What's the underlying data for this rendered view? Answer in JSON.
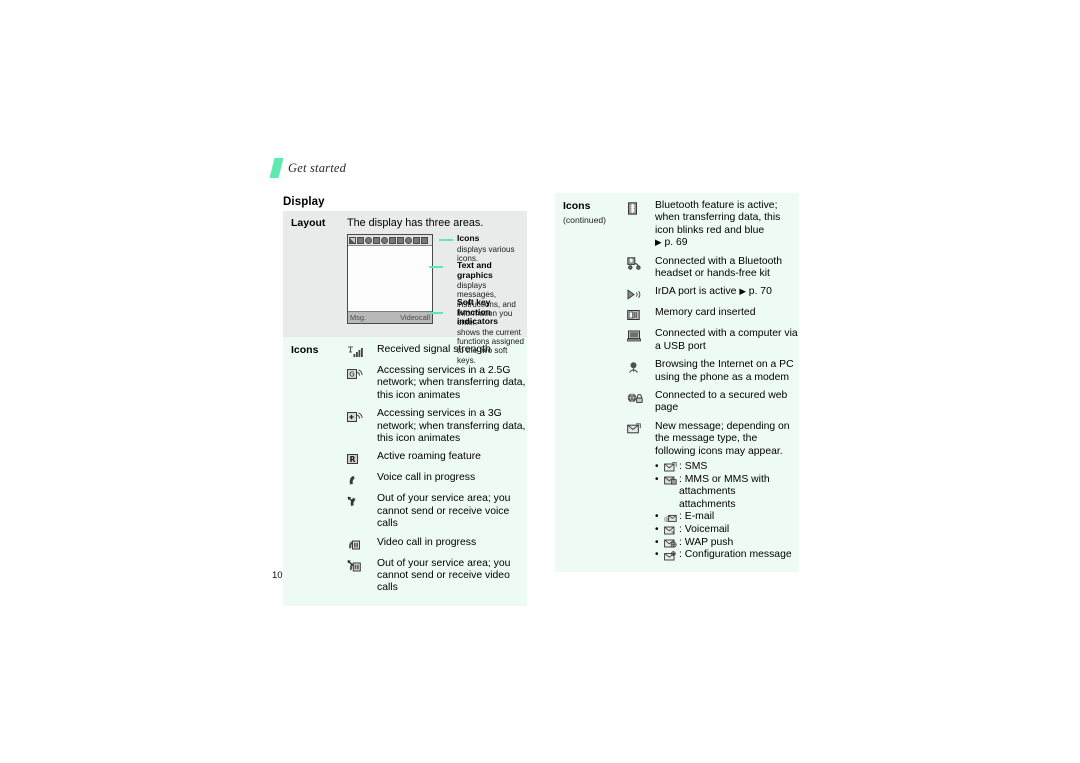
{
  "page": {
    "running_header": "Get started",
    "folio": "10",
    "section_heading": "Display",
    "accent_color": "#5ee9ae",
    "panel_gray": "#e9eaea",
    "panel_mint": "#eefaf4"
  },
  "layout_row": {
    "label": "Layout",
    "intro": "The display has three areas.",
    "softkeys": {
      "left": "Msg.",
      "right": "Videocall"
    },
    "callouts": [
      {
        "icon": "icons-callout-icon",
        "title": "Icons",
        "desc": "displays various icons."
      },
      {
        "icon": "text-graphics-callout-icon",
        "title": "Text and graphics",
        "desc": "displays messages, instructions, and information you enter."
      },
      {
        "icon": "softkey-callout-icon",
        "title": "Soft key function indicators",
        "desc": "shows the current functions assigned to the two soft keys."
      }
    ]
  },
  "icons_row_left": {
    "label": "Icons",
    "items": [
      {
        "icon": "signal-strength-icon",
        "text": "Received signal strength"
      },
      {
        "icon": "network-2-5g-icon",
        "text": "Accessing services in a 2.5G network; when transferring data, this icon animates"
      },
      {
        "icon": "network-3g-icon",
        "text": "Accessing services in a 3G network; when transferring data, this icon animates"
      },
      {
        "icon": "roaming-icon",
        "text": "Active roaming feature"
      },
      {
        "icon": "voice-call-icon",
        "text": "Voice call in progress"
      },
      {
        "icon": "voice-call-no-service-icon",
        "text": "Out of your service area; you cannot send or receive voice calls"
      },
      {
        "icon": "video-call-icon",
        "text": "Video call in progress"
      },
      {
        "icon": "video-call-no-service-icon",
        "text": "Out of your service area; you cannot send or receive video calls"
      }
    ]
  },
  "icons_row_right": {
    "label": "Icons",
    "label_sub": "(continued)",
    "items": [
      {
        "icon": "bluetooth-icon",
        "text": "Bluetooth feature is active; when transferring data, this icon blinks red and blue",
        "ref": "p. 69"
      },
      {
        "icon": "bluetooth-headset-icon",
        "text": "Connected with a Bluetooth headset or hands-free kit"
      },
      {
        "icon": "irda-icon",
        "text": "IrDA port is active",
        "ref": "p. 70"
      },
      {
        "icon": "memory-card-icon",
        "text": "Memory card inserted"
      },
      {
        "icon": "usb-computer-icon",
        "text": "Connected with a computer via a USB port"
      },
      {
        "icon": "modem-icon",
        "text": "Browsing the Internet on a PC using the phone as a modem"
      },
      {
        "icon": "secure-web-icon",
        "text": "Connected to a secured web page"
      },
      {
        "icon": "new-message-icon",
        "text": "New message; depending on the message type, the following icons may appear."
      }
    ],
    "message_types": [
      {
        "icon": "sms-icon",
        "text": ": SMS"
      },
      {
        "icon": "mms-icon",
        "text": ": MMS or MMS with attachments"
      },
      {
        "icon": "email-icon",
        "text": ": E-mail"
      },
      {
        "icon": "voicemail-icon",
        "text": ": Voicemail"
      },
      {
        "icon": "wap-push-icon",
        "text": ": WAP push"
      },
      {
        "icon": "configuration-message-icon",
        "text": ": Configuration message"
      }
    ],
    "bullet_char": "•",
    "ref_arrow": "▶"
  }
}
